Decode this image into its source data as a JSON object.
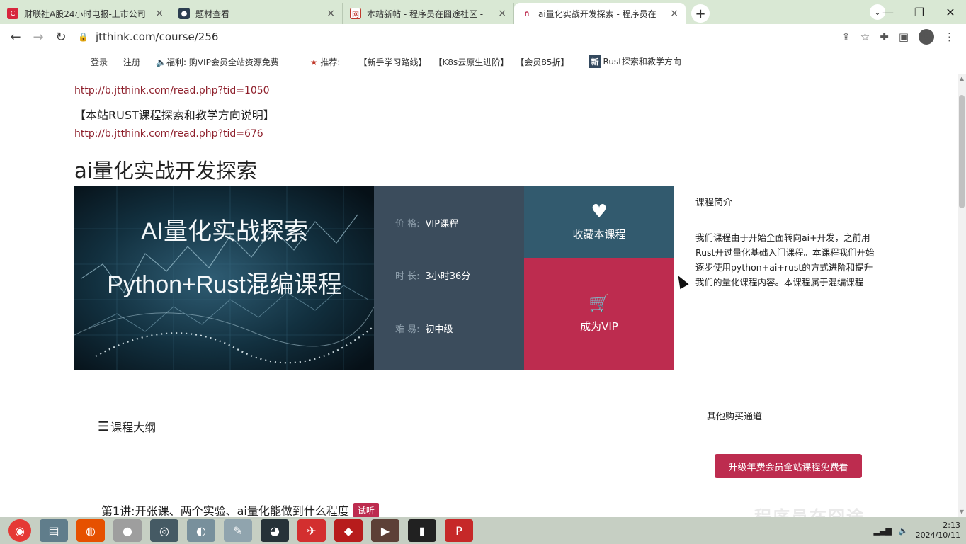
{
  "browser": {
    "tabs": [
      {
        "title": "财联社A股24小时电报-上市公司",
        "icon": "C",
        "color": "#d7263d"
      },
      {
        "title": "题材查看",
        "icon": "●",
        "color": "#2c3e50"
      },
      {
        "title": "本站新帖 - 程序员在囧途社区 - ",
        "icon": "网",
        "color": "#c0392b"
      },
      {
        "title": "ai量化实战开发探索 - 程序员在",
        "icon": "∩",
        "color": "#bd2c4f"
      }
    ],
    "new_tab": "+",
    "url": "jtthink.com/course/256"
  },
  "site_nav": {
    "login": "登录",
    "register": "注册",
    "welfare": "福利: 购VIP会员全站资源免费",
    "recommend": "推荐:",
    "links": [
      "【新手学习路线】",
      "【K8s云原生进阶】",
      "【会员85折】"
    ],
    "new_badge": "新",
    "rust_link": "Rust探索和教学方向"
  },
  "content": {
    "link1": "http://b.jtthink.com/read.php?tid=1050",
    "note": "【本站RUST课程探索和教学方向说明】",
    "link2": "http://b.jtthink.com/read.php?tid=676",
    "title": "ai量化实战开发探索",
    "banner": {
      "line1": "AI量化实战探索",
      "line2": "Python+Rust混编课程"
    },
    "info": {
      "price_label": "价  格:",
      "price_value": "VIP课程",
      "duration_label": "时  长:",
      "duration_value": "3小时36分",
      "level_label": "难  易:",
      "level_value": "初中级"
    },
    "favorite": "收藏本课程",
    "become_vip": "成为VIP",
    "intro_title": "课程简介",
    "intro_text": "我们课程由于开始全面转向ai+开发，之前用Rust开过量化基础入门课程。本课程我们开始逐步使用python+ai+rust的方式进阶和提升我们的量化课程内容。本课程属于混编课程",
    "outline_title": "课程大纲",
    "other_channels": "其他购买通道",
    "upgrade_button": "升级年费会员全站课程免费看",
    "lesson1": "第1讲:开张课、两个实验、ai量化能做到什么程度",
    "trial_badge": "试听",
    "watermark": "程序员在囧途"
  },
  "taskbar": {
    "date": "2024/10/11",
    "time": "2:13"
  }
}
